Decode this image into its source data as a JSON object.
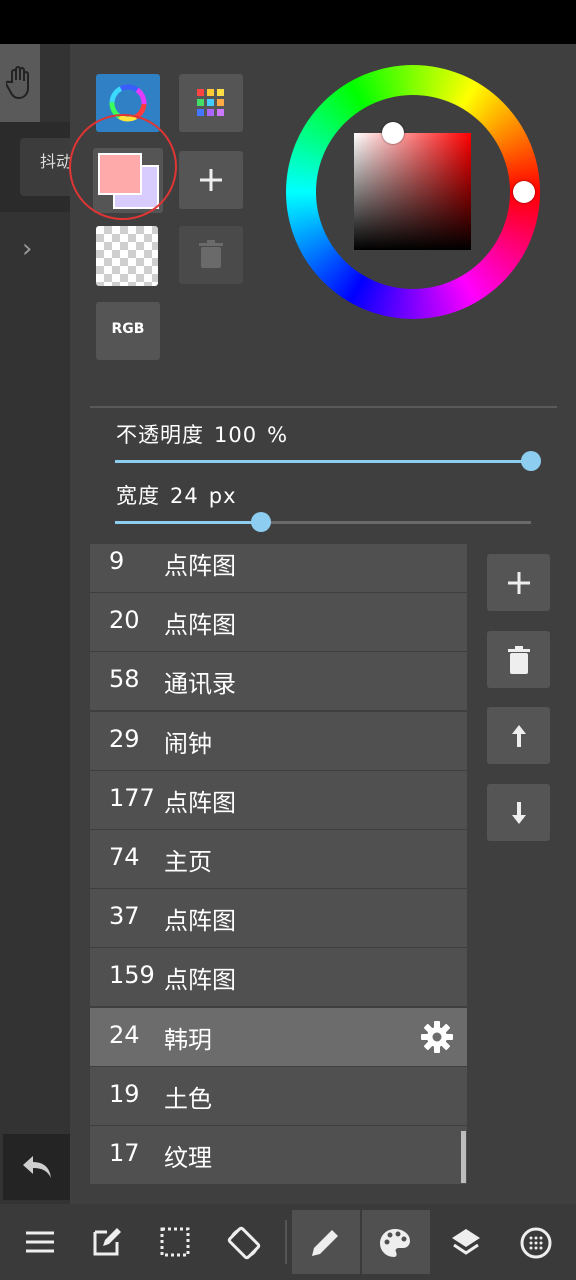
{
  "left_strip": {
    "tab_label": "抖动",
    "expand_icon": "chevron-right-icon",
    "hand_icon": "hand-icon",
    "undo_icon": "undo-icon"
  },
  "color_panel": {
    "rgb_label": "RGB",
    "foreground_color": "#ffaaaa",
    "background_color": "#d8ccff",
    "wheel_knob_color": "#ff0000",
    "icons": [
      "color-wheel-icon",
      "palette-grid-icon",
      "plus-icon",
      "trash-icon"
    ]
  },
  "sliders": {
    "opacity": {
      "label": "不透明度",
      "value": "100",
      "unit": "%",
      "fraction": 1.0
    },
    "width": {
      "label": "宽度",
      "value": "24",
      "unit": "px",
      "fraction": 0.35
    }
  },
  "brushes": [
    {
      "num": "9",
      "name": "点阵图"
    },
    {
      "num": "20",
      "name": "点阵图"
    },
    {
      "num": "58",
      "name": "通讯录"
    },
    {
      "num": "29",
      "name": "闹钟"
    },
    {
      "num": "177",
      "name": "点阵图"
    },
    {
      "num": "74",
      "name": "主页"
    },
    {
      "num": "37",
      "name": "点阵图"
    },
    {
      "num": "159",
      "name": "点阵图"
    },
    {
      "num": "24",
      "name": "韩玥",
      "selected": true
    },
    {
      "num": "19",
      "name": "土色"
    },
    {
      "num": "17",
      "name": "纹理"
    }
  ],
  "brush_actions": [
    "add-brush-icon",
    "delete-brush-icon",
    "move-up-icon",
    "move-down-icon"
  ],
  "toolbar": {
    "items": [
      "menu-icon",
      "edit-icon",
      "selection-icon",
      "rotate-icon",
      "pen-icon",
      "palette-icon",
      "layers-icon",
      "grid-icon"
    ],
    "active": [
      "pen-icon",
      "palette-icon"
    ]
  }
}
